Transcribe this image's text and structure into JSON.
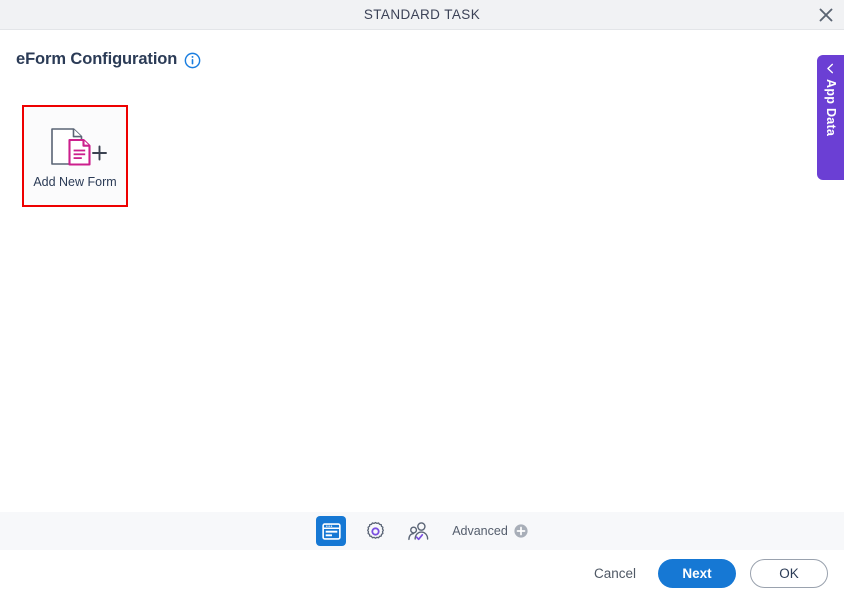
{
  "window": {
    "title": "STANDARD TASK",
    "close_icon": "close-icon"
  },
  "header": {
    "title": "eForm Configuration",
    "info_icon": "info-circle-icon"
  },
  "main": {
    "cards": [
      {
        "label": "Add New Form",
        "icon": "add-new-form-icon",
        "selected": true
      }
    ]
  },
  "side_panel": {
    "label": "App Data",
    "chevron_icon": "chevron-left-icon",
    "color": "#6b3fd4"
  },
  "toolbar": {
    "items": [
      {
        "icon": "form-designer-icon",
        "active": true
      },
      {
        "icon": "gear-icon",
        "active": false
      },
      {
        "icon": "user-check-icon",
        "active": false
      }
    ],
    "advanced_label": "Advanced",
    "advanced_icon": "plus-circle-icon"
  },
  "footer": {
    "cancel_label": "Cancel",
    "next_label": "Next",
    "ok_label": "OK"
  },
  "colors": {
    "accent_blue": "#1678d4",
    "purple": "#6b3fd4",
    "magenta": "#cc1f8d",
    "selection_red": "#ee0000",
    "titlebar_bg": "#f1f2f4",
    "toolbar_bg": "#f7f8fa"
  }
}
